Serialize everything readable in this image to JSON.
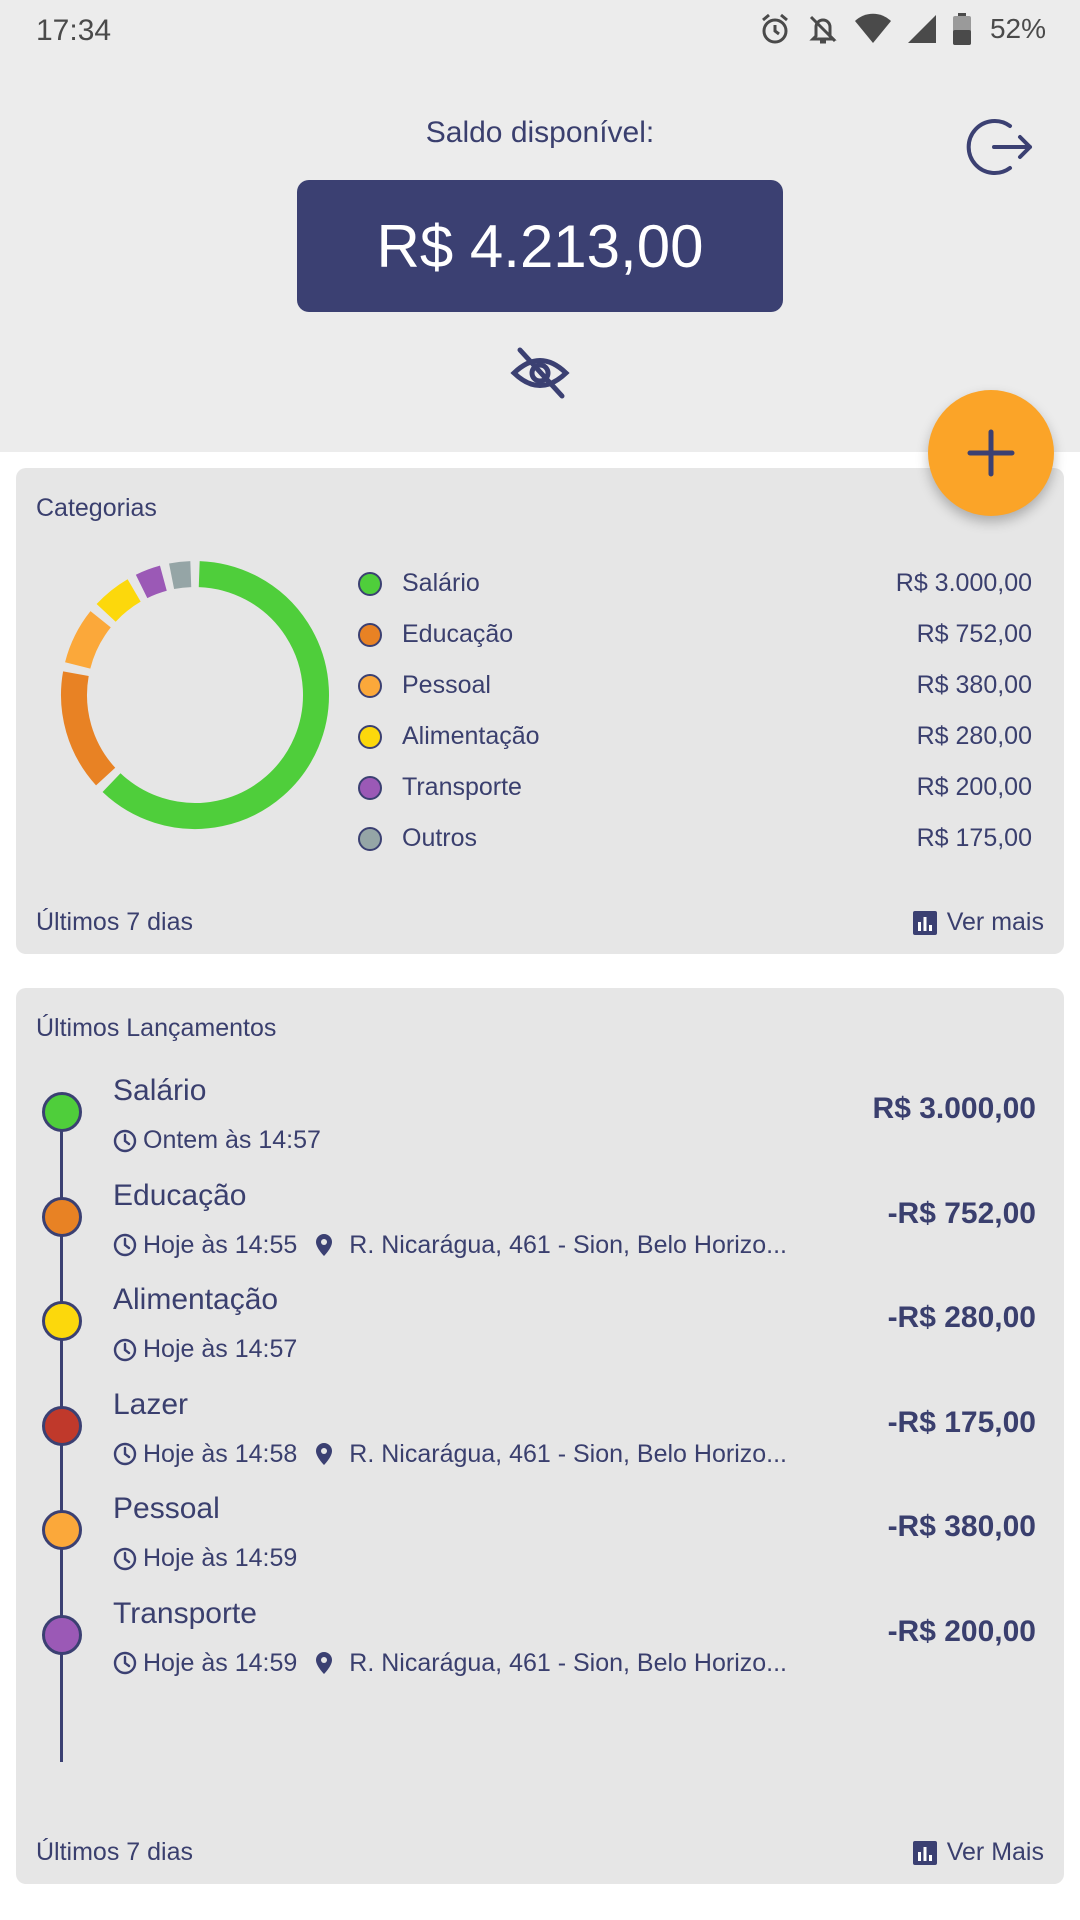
{
  "status_bar": {
    "time": "17:34",
    "battery": "52%"
  },
  "header": {
    "balance_label": "Saldo disponível:",
    "balance_value": "R$ 4.213,00"
  },
  "colors": {
    "primary": "#3b4072",
    "fab": "#fba428",
    "salario": "#4fce3b",
    "educacao": "#e88224",
    "pessoal": "#fba83a",
    "alimentacao": "#fcd80c",
    "transporte": "#9b59b6",
    "outros": "#95a5a6",
    "lazer": "#c0392b"
  },
  "categories": {
    "title": "Categorias",
    "items": [
      {
        "name": "Salário",
        "value": "R$ 3.000,00",
        "amount": 3000,
        "color": "#4fce3b"
      },
      {
        "name": "Educação",
        "value": "R$ 752,00",
        "amount": 752,
        "color": "#e88224"
      },
      {
        "name": "Pessoal",
        "value": "R$ 380,00",
        "amount": 380,
        "color": "#fba83a"
      },
      {
        "name": "Alimentação",
        "value": "R$ 280,00",
        "amount": 280,
        "color": "#fcd80c"
      },
      {
        "name": "Transporte",
        "value": "R$ 200,00",
        "amount": 200,
        "color": "#9b59b6"
      },
      {
        "name": "Outros",
        "value": "R$ 175,00",
        "amount": 175,
        "color": "#95a5a6"
      }
    ],
    "footer_left": "Últimos 7 dias",
    "footer_right": "Ver mais"
  },
  "transactions": {
    "title": "Últimos Lançamentos",
    "items": [
      {
        "name": "Salário",
        "time": "Ontem às 14:57",
        "location": "",
        "amount": "R$ 3.000,00",
        "color": "#4fce3b"
      },
      {
        "name": "Educação",
        "time": "Hoje às 14:55",
        "location": "R. Nicarágua, 461 - Sion, Belo Horizo...",
        "amount": "-R$ 752,00",
        "color": "#e88224"
      },
      {
        "name": "Alimentação",
        "time": "Hoje às 14:57",
        "location": "",
        "amount": "-R$ 280,00",
        "color": "#fcd80c"
      },
      {
        "name": "Lazer",
        "time": "Hoje às 14:58",
        "location": "R. Nicarágua, 461 - Sion, Belo Horizo...",
        "amount": "-R$ 175,00",
        "color": "#c0392b"
      },
      {
        "name": "Pessoal",
        "time": "Hoje às 14:59",
        "location": "",
        "amount": "-R$ 380,00",
        "color": "#fba83a"
      },
      {
        "name": "Transporte",
        "time": "Hoje às 14:59",
        "location": "R. Nicarágua, 461 - Sion, Belo Horizo...",
        "amount": "-R$ 200,00",
        "color": "#9b59b6"
      }
    ],
    "footer_left": "Últimos 7 dias",
    "footer_right": "Ver Mais"
  }
}
